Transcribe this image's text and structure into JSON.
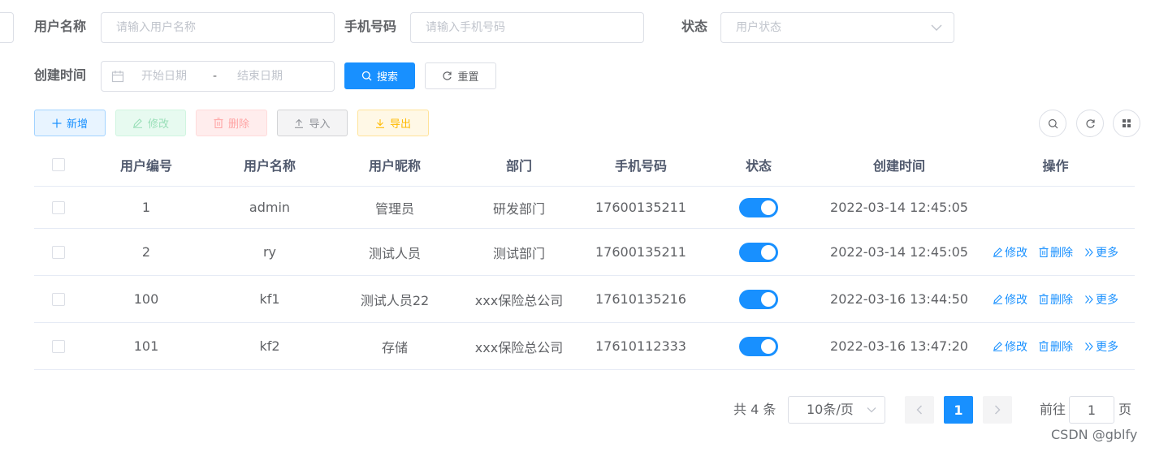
{
  "search": {
    "username_label": "用户名称",
    "username_placeholder": "请输入用户名称",
    "phone_label": "手机号码",
    "phone_placeholder": "请输入手机号码",
    "status_label": "状态",
    "status_placeholder": "用户状态",
    "created_label": "创建时间",
    "start_placeholder": "开始日期",
    "date_separator": "-",
    "end_placeholder": "结束日期",
    "search_button": "搜索",
    "reset_button": "重置"
  },
  "toolbar": {
    "add": "新增",
    "edit": "修改",
    "delete": "删除",
    "import": "导入",
    "export": "导出"
  },
  "table": {
    "headers": [
      "用户编号",
      "用户名称",
      "用户昵称",
      "部门",
      "手机号码",
      "状态",
      "创建时间",
      "操作"
    ],
    "rows": [
      {
        "id": "1",
        "username": "admin",
        "nickname": "管理员",
        "dept": "研发部门",
        "phone": "17600135211",
        "status": true,
        "created": "2022-03-14 12:45:05",
        "actions": false
      },
      {
        "id": "2",
        "username": "ry",
        "nickname": "测试人员",
        "dept": "测试部门",
        "phone": "17600135211",
        "status": true,
        "created": "2022-03-14 12:45:05",
        "actions": true
      },
      {
        "id": "100",
        "username": "kf1",
        "nickname": "测试人员22",
        "dept": "xxx保险总公司",
        "phone": "17610135216",
        "status": true,
        "created": "2022-03-16 13:44:50",
        "actions": true
      },
      {
        "id": "101",
        "username": "kf2",
        "nickname": "存储",
        "dept": "xxx保险总公司",
        "phone": "17610112333",
        "status": true,
        "created": "2022-03-16 13:47:20",
        "actions": true
      }
    ],
    "action_labels": {
      "edit": "修改",
      "delete": "删除",
      "more": "更多"
    }
  },
  "pagination": {
    "total_text": "共 4 条",
    "page_size": "10条/页",
    "current_page": "1",
    "goto_label": "前往",
    "goto_value": "1",
    "page_suffix": "页"
  },
  "watermark": "CSDN @gblfy",
  "colors": {
    "primary": "#1890ff",
    "text": "#606266",
    "border": "#dcdfe6"
  }
}
